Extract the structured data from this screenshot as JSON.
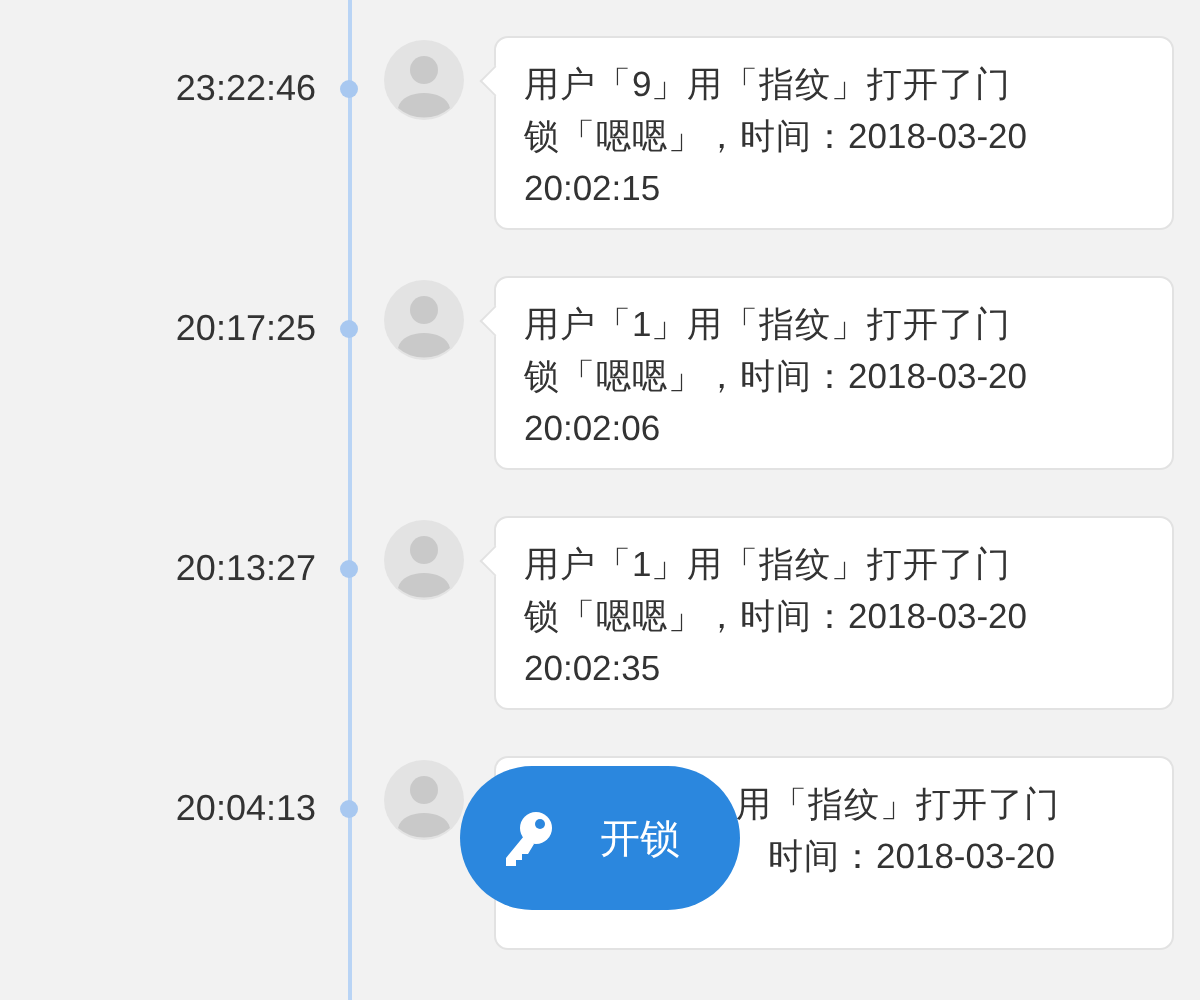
{
  "events": [
    {
      "time": "23:22:46",
      "kind": "full",
      "lines": [
        "用户「9」用「指纹」打开了门",
        "锁「嗯嗯」，时间：2018-03-20",
        "20:02:15"
      ]
    },
    {
      "time": "20:17:25",
      "kind": "full",
      "lines": [
        "用户「1」用「指纹」打开了门",
        "锁「嗯嗯」，时间：2018-03-20",
        "20:02:06"
      ]
    },
    {
      "time": "20:13:27",
      "kind": "full",
      "lines": [
        "用户「1」用「指纹」打开了门",
        "锁「嗯嗯」，时间：2018-03-20",
        "20:02:35"
      ]
    },
    {
      "time": "20:04:13",
      "kind": "partly_covered",
      "lines": [
        "用「指纹」打开了门",
        "时间：2018-03-20"
      ]
    }
  ],
  "unlock_button": {
    "label": "开锁"
  }
}
